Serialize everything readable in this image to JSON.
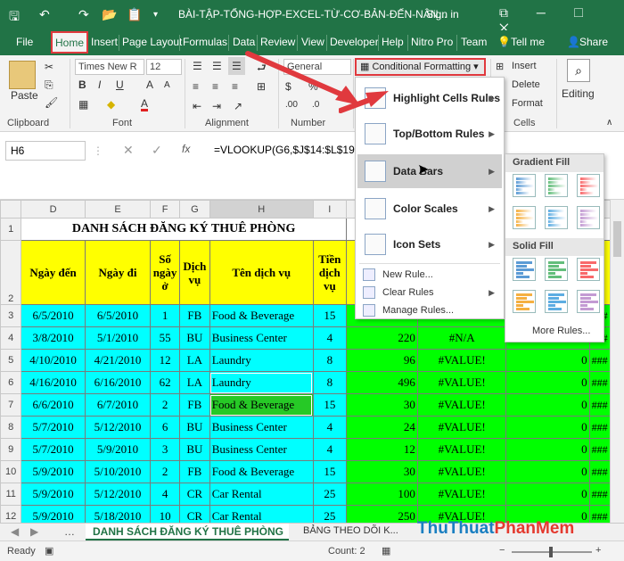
{
  "titlebar": {
    "title": "BÀI-TẬP-TỔNG-HỢP-EXCEL-TỪ-CƠ-BẢN-ĐẾN-NÂN...",
    "signin": "Sign in",
    "restore": "⧉ ─ ☐ ✕"
  },
  "tabs": [
    "File",
    "Home",
    "Insert",
    "Page Layout",
    "Formulas",
    "Data",
    "Review",
    "View",
    "Developer",
    "Help",
    "Nitro Pro",
    "Team"
  ],
  "tellme": "Tell me",
  "share": "Share",
  "ribbon": {
    "paste": "Paste",
    "clipboard": "Clipboard",
    "font_name": "Times New R",
    "font_size": "12",
    "font": "Font",
    "alignment": "Alignment",
    "number_format": "General",
    "number": "Number",
    "cond_format": "Conditional Formatting",
    "insert": "Insert",
    "delete": "Delete",
    "format": "Format",
    "cells": "Cells",
    "editing": "Editing"
  },
  "formula": {
    "namebox": "H6",
    "fx": "fx",
    "value": "=VLOOKUP(G6,$J$14:$L$19,"
  },
  "columns": [
    "D",
    "E",
    "F",
    "G",
    "H",
    "I"
  ],
  "sheet": {
    "title": "DANH SÁCH ĐĂNG KÝ THUÊ PHÒNG",
    "headers": [
      "Ngày đến",
      "Ngày đi",
      "Số ngày ở",
      "Dịch vụ",
      "Tên dịch vụ",
      "Tiền dịch vụ"
    ],
    "rows": [
      {
        "n": "3",
        "d": "6/5/2010",
        "e": "6/5/2010",
        "f": "1",
        "g": "FB",
        "h": "Food & Beverage",
        "i": "15",
        "j": "",
        "k": "",
        "l": ""
      },
      {
        "n": "4",
        "d": "3/8/2010",
        "e": "5/1/2010",
        "f": "55",
        "g": "BU",
        "h": "Business Center",
        "i": "4",
        "j": "220",
        "k": "#N/A",
        "l": ""
      },
      {
        "n": "5",
        "d": "4/10/2010",
        "e": "4/21/2010",
        "f": "12",
        "g": "LA",
        "h": "Laundry",
        "i": "8",
        "j": "96",
        "k": "#VALUE!",
        "l": "0"
      },
      {
        "n": "6",
        "d": "4/16/2010",
        "e": "6/16/2010",
        "f": "62",
        "g": "LA",
        "h": "Laundry",
        "i": "8",
        "j": "496",
        "k": "#VALUE!",
        "l": "0"
      },
      {
        "n": "7",
        "d": "6/6/2010",
        "e": "6/7/2010",
        "f": "2",
        "g": "FB",
        "h": "Food & Beverage",
        "i": "15",
        "j": "30",
        "k": "#VALUE!",
        "l": "0"
      },
      {
        "n": "8",
        "d": "5/7/2010",
        "e": "5/12/2010",
        "f": "6",
        "g": "BU",
        "h": "Business Center",
        "i": "4",
        "j": "24",
        "k": "#VALUE!",
        "l": "0"
      },
      {
        "n": "9",
        "d": "5/7/2010",
        "e": "5/9/2010",
        "f": "3",
        "g": "BU",
        "h": "Business Center",
        "i": "4",
        "j": "12",
        "k": "#VALUE!",
        "l": "0"
      },
      {
        "n": "10",
        "d": "5/9/2010",
        "e": "5/10/2010",
        "f": "2",
        "g": "FB",
        "h": "Food & Beverage",
        "i": "15",
        "j": "30",
        "k": "#VALUE!",
        "l": "0"
      },
      {
        "n": "11",
        "d": "5/9/2010",
        "e": "5/12/2010",
        "f": "4",
        "g": "CR",
        "h": "Car Rental",
        "i": "25",
        "j": "100",
        "k": "#VALUE!",
        "l": "0"
      },
      {
        "n": "12",
        "d": "5/9/2010",
        "e": "5/18/2010",
        "f": "10",
        "g": "CR",
        "h": "Car Rental",
        "i": "25",
        "j": "250",
        "k": "#VALUE!",
        "l": "0"
      }
    ]
  },
  "menu": {
    "highlight": "Highlight Cells Rules",
    "topbottom": "Top/Bottom Rules",
    "databars": "Data Bars",
    "colorscales": "Color Scales",
    "iconsets": "Icon Sets",
    "newrule": "New Rule...",
    "clearrules": "Clear Rules",
    "managerules": "Manage Rules..."
  },
  "submenu": {
    "gradient": "Gradient Fill",
    "solid": "Solid Fill",
    "more": "More Rules..."
  },
  "sheettabs": {
    "active": "DANH SÁCH ĐĂNG KÝ THUÊ PHÒNG",
    "other": "BẢNG THEO DÕI K..."
  },
  "status": {
    "ready": "Ready",
    "count": "Count: 2"
  },
  "watermark": {
    "part1": "Thu",
    "part2": "Thuat",
    "part3": "PhanMem",
    ".vn": ".vn"
  },
  "colors": {
    "excel_green": "#217346",
    "cyan": "#00ffff",
    "yellow": "#ffff00",
    "green": "#00ff00",
    "highlight_red": "#e0393e"
  }
}
